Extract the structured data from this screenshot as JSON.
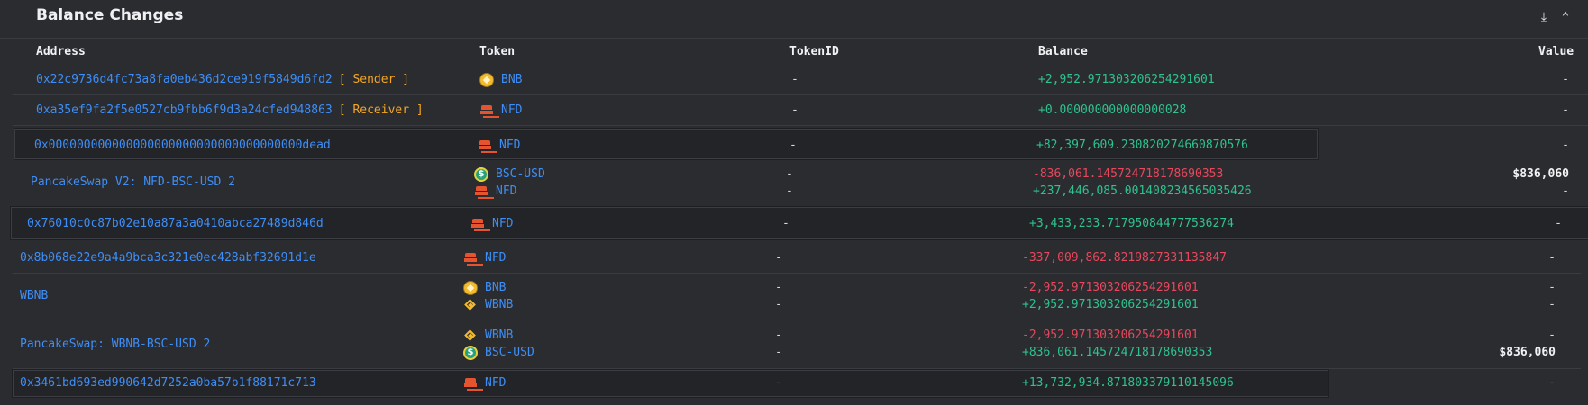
{
  "header": {
    "title": "Balance Changes",
    "download_icon": "download-icon",
    "collapse_icon": "chevron-up-icon"
  },
  "columns": {
    "address": "Address",
    "token": "Token",
    "token_id": "TokenID",
    "balance": "Balance",
    "value": "Value"
  },
  "icons": {
    "BNB": "bnb-token-icon",
    "NFD": "nfd-token-icon",
    "BSC-USD": "bsc-usd-token-icon",
    "WBNB": "wbnb-token-icon"
  },
  "colors": {
    "link": "#3e8ef7",
    "positive": "#2ec28e",
    "negative": "#e8475c",
    "tag": "#f5a623"
  },
  "rows": [
    {
      "address": "0x22c9736d4fc73a8fa0eb436d2ce919f5849d6fd2",
      "tag": "[ Sender ]",
      "lines": [
        {
          "token": "BNB",
          "token_id": "-",
          "balance": "+2,952.971303206254291601",
          "value": "-"
        }
      ]
    },
    {
      "address": "0xa35ef9fa2f5e0527cb9fbb6f9d3a24cfed948863",
      "tag": "[ Receiver ]",
      "lines": [
        {
          "token": "NFD",
          "token_id": "-",
          "balance": "+0.000000000000000028",
          "value": "-"
        }
      ]
    },
    {
      "address": "0x000000000000000000000000000000000000dead",
      "tag": "",
      "lines": [
        {
          "token": "NFD",
          "token_id": "-",
          "balance": "+82,397,609.230820274660870576",
          "value": "-"
        }
      ]
    },
    {
      "address": "PancakeSwap V2: NFD-BSC-USD 2",
      "tag": "",
      "lines": [
        {
          "token": "BSC-USD",
          "token_id": "-",
          "balance": "-836,061.145724718178690353",
          "value": "$836,060"
        },
        {
          "token": "NFD",
          "token_id": "-",
          "balance": "+237,446,085.001408234565035426",
          "value": "-"
        }
      ]
    },
    {
      "address": "0x76010c0c87b02e10a87a3a0410abca27489d846d",
      "tag": "",
      "lines": [
        {
          "token": "NFD",
          "token_id": "-",
          "balance": "+3,433,233.717950844777536274",
          "value": "-"
        }
      ]
    },
    {
      "address": "0x8b068e22e9a4a9bca3c321e0ec428abf32691d1e",
      "tag": "",
      "lines": [
        {
          "token": "NFD",
          "token_id": "-",
          "balance": "-337,009,862.8219827331135847",
          "value": "-"
        }
      ]
    },
    {
      "address": "WBNB",
      "tag": "",
      "lines": [
        {
          "token": "BNB",
          "token_id": "-",
          "balance": "-2,952.971303206254291601",
          "value": "-"
        },
        {
          "token": "WBNB",
          "token_id": "-",
          "balance": "+2,952.971303206254291601",
          "value": "-"
        }
      ]
    },
    {
      "address": "PancakeSwap: WBNB-BSC-USD 2",
      "tag": "",
      "lines": [
        {
          "token": "WBNB",
          "token_id": "-",
          "balance": "-2,952.971303206254291601",
          "value": "-"
        },
        {
          "token": "BSC-USD",
          "token_id": "-",
          "balance": "+836,061.145724718178690353",
          "value": "$836,060"
        }
      ]
    },
    {
      "address": "0x3461bd693ed990642d7252a0ba57b1f88171c713",
      "tag": "",
      "lines": [
        {
          "token": "NFD",
          "token_id": "-",
          "balance": "+13,732,934.871803379110145096",
          "value": "-"
        }
      ]
    }
  ]
}
